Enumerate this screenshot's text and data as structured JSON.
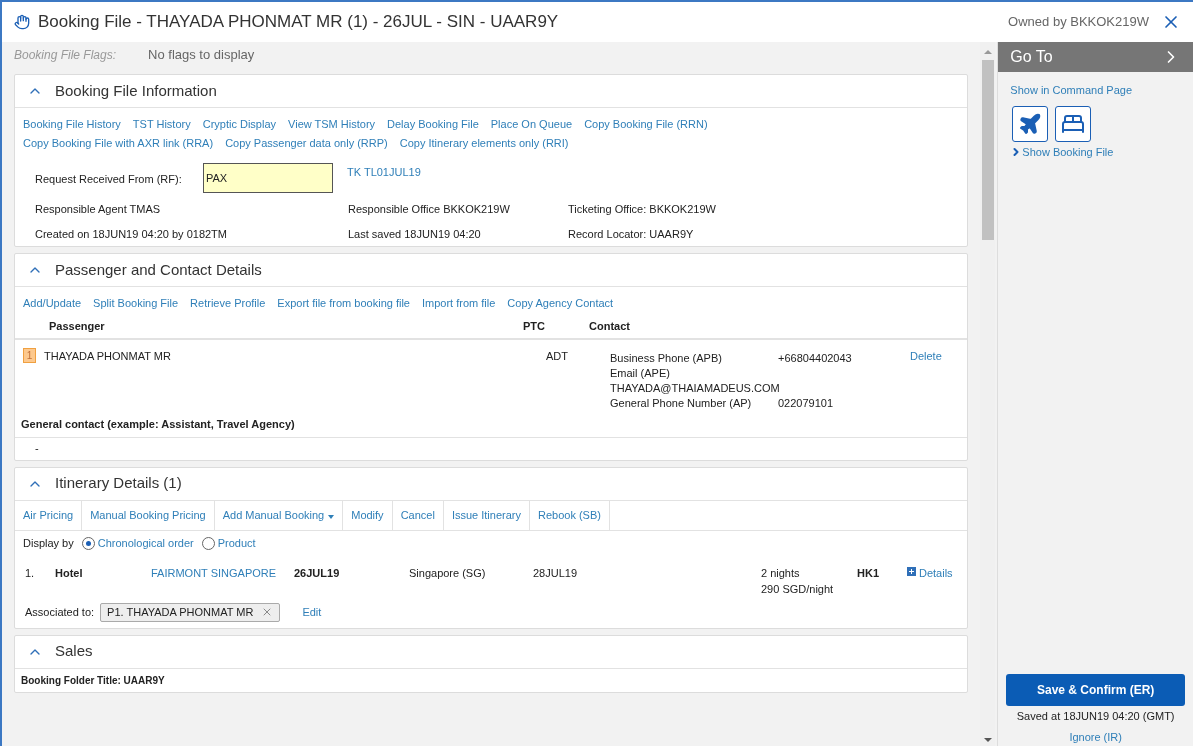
{
  "window": {
    "title": "Booking File - THAYADA PHONMAT MR (1) - 26JUL - SIN - UAAR9Y",
    "owner": "Owned by BKKOK219W"
  },
  "flags": {
    "label": "Booking File Flags:",
    "value": "No flags to display"
  },
  "booking_info": {
    "title": "Booking File Information",
    "expanded": true,
    "links": [
      "Booking File History",
      "TST History",
      "Cryptic Display",
      "View TSM History",
      "Delay Booking File",
      "Place On Queue",
      "Copy Booking File (RRN)",
      "Copy Booking File with AXR link (RRA)",
      "Copy Passenger data only (RRP)",
      "Copy Itinerary elements only (RRI)"
    ],
    "rf": {
      "label": "Request Received From (RF):",
      "value": "PAX"
    },
    "tk": "TK TL01JUL19",
    "details": [
      [
        "Responsible Agent TMAS",
        "Responsible Office BKKOK219W",
        "Ticketing Office: BKKOK219W"
      ],
      [
        "Created on 18JUN19 04:20 by 0182TM",
        "Last saved 18JUN19 04:20",
        "Record Locator: UAAR9Y"
      ]
    ]
  },
  "passengers": {
    "title": "Passenger and Contact Details",
    "expanded": true,
    "links": [
      "Add/Update",
      "Split Booking File",
      "Retrieve Profile",
      "Export file from booking file",
      "Import from file",
      "Copy Agency Contact"
    ],
    "columns": [
      "Passenger",
      "PTC",
      "Contact"
    ],
    "rows": [
      {
        "number": "1",
        "name": "THAYADA PHONMAT MR",
        "ptc": "ADT",
        "contacts": [
          {
            "label": "Business Phone (APB)",
            "value": "+66804402043"
          },
          {
            "label": "Email (APE)"
          },
          {
            "label": "THAYADA@THAIAMADEUS.COM"
          },
          {
            "label": "General Phone Number (AP)",
            "value": "022079101"
          }
        ],
        "action": "Delete"
      }
    ],
    "general_contact": {
      "label": "General contact (example: Assistant, Travel Agency)",
      "value": "-"
    }
  },
  "itinerary": {
    "title": "Itinerary Details (1)",
    "expanded": true,
    "toolbar": [
      {
        "label": "Air Pricing",
        "dropdown": false
      },
      {
        "label": "Manual Booking Pricing",
        "dropdown": false
      },
      {
        "label": "Add Manual Booking",
        "dropdown": true
      },
      {
        "label": "Modify",
        "dropdown": false
      },
      {
        "label": "Cancel",
        "dropdown": false
      },
      {
        "label": "Issue Itinerary",
        "dropdown": false
      },
      {
        "label": "Rebook (SB)",
        "dropdown": false
      }
    ],
    "display_by": "Display by",
    "options": [
      {
        "label": "Chronological order",
        "selected": true
      },
      {
        "label": "Product",
        "selected": false
      }
    ],
    "items": [
      {
        "index": "1.",
        "type": "Hotel",
        "name": "FAIRMONT SINGAPORE",
        "checkin": "26JUL19",
        "city": "Singapore (SG)",
        "checkout": "28JUL19",
        "nights": "2 nights",
        "rate": "290 SGD/night",
        "status": "HK1",
        "details": "Details"
      }
    ],
    "associated": {
      "label": "Associated to:",
      "chip": "P1. THAYADA PHONMAT MR",
      "edit": "Edit"
    }
  },
  "sales": {
    "title": "Sales",
    "expanded": true,
    "folder_title": "Booking Folder Title: UAAR9Y"
  },
  "goto": {
    "title": "Go To",
    "command_link": "Show in Command Page",
    "booking_link": "Show Booking File"
  },
  "footer": {
    "save": "Save & Confirm (ER)",
    "saved": "Saved at 18JUN19 04:20 (GMT)",
    "ignore": "Ignore (IR)"
  }
}
